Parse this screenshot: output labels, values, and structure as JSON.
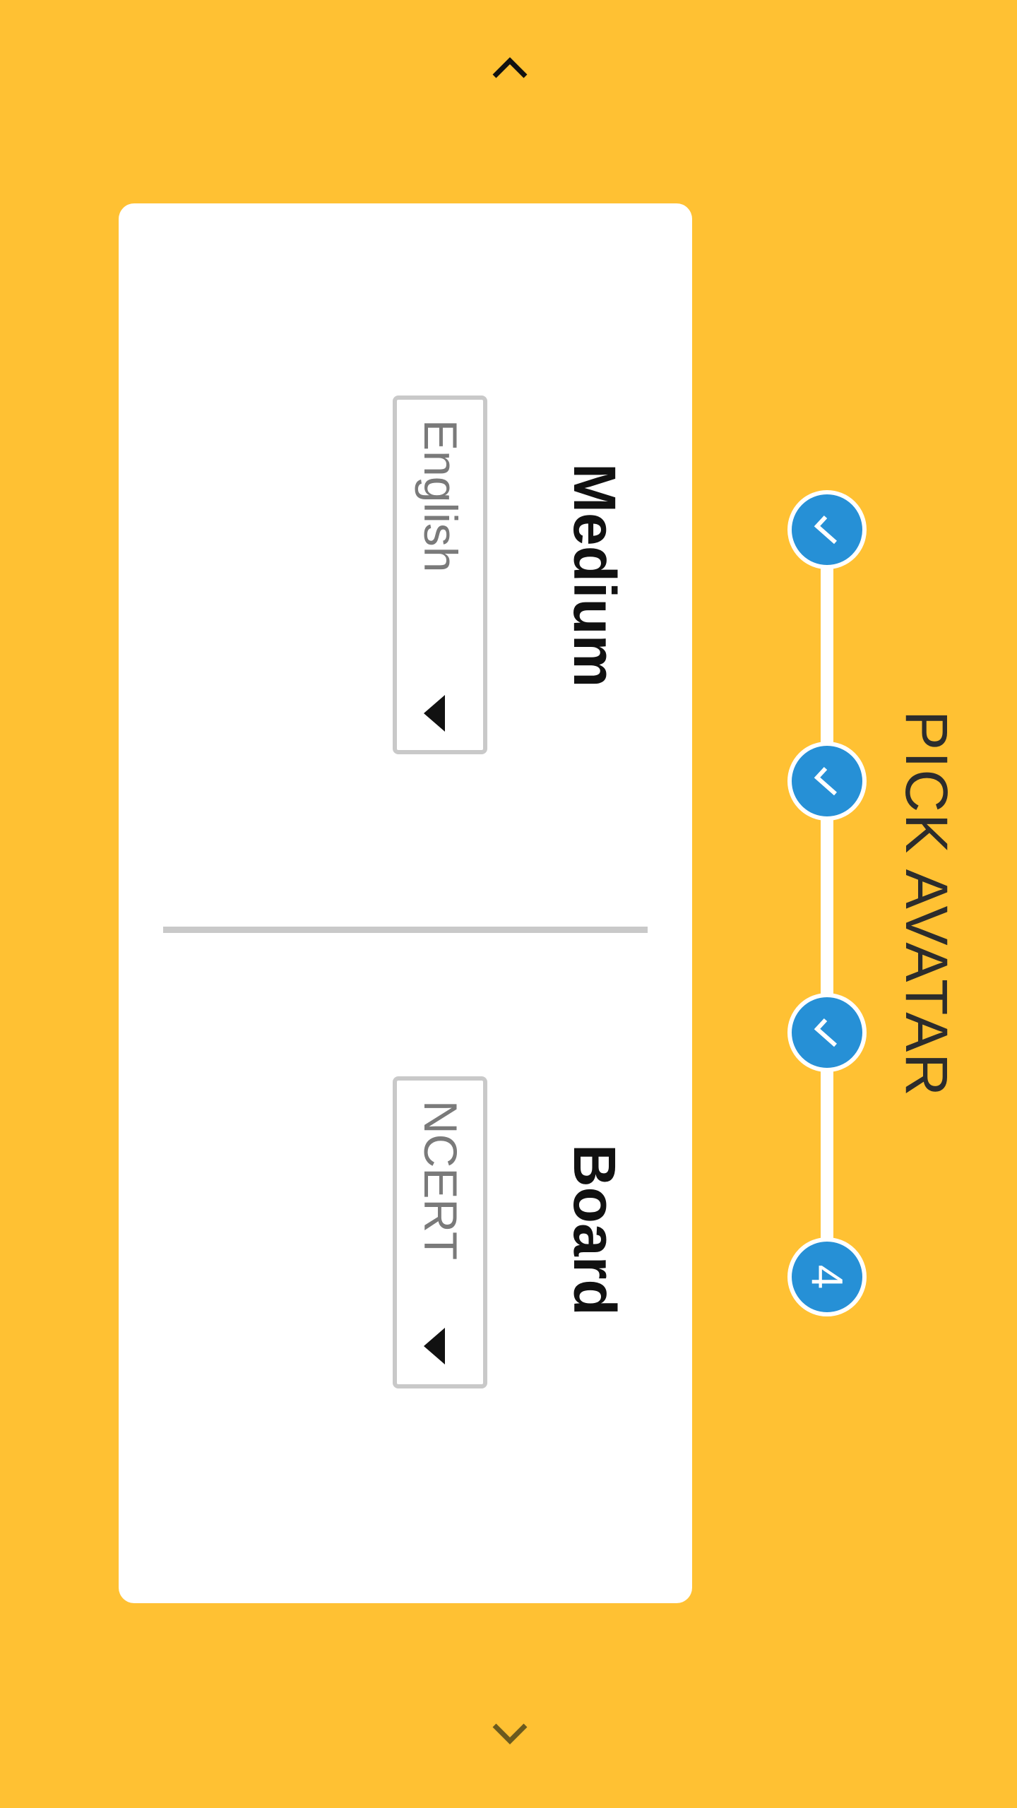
{
  "header": {
    "title": "PICK AVATAR"
  },
  "stepper": {
    "steps": [
      {
        "state": "done",
        "icon": "checkmark-icon"
      },
      {
        "state": "done",
        "icon": "checkmark-icon"
      },
      {
        "state": "done",
        "icon": "checkmark-icon"
      },
      {
        "state": "current",
        "label": "4"
      }
    ],
    "step_color": "#2690D6"
  },
  "form": {
    "medium": {
      "label": "Medium",
      "value": "English"
    },
    "board": {
      "label": "Board",
      "value": "NCERT"
    }
  },
  "navigation": {
    "prev_icon": "chevron-left-icon",
    "next_icon": "chevron-right-icon"
  },
  "theme": {
    "background": "#FFC133",
    "card": "#FFFFFF",
    "accent": "#2690D6"
  }
}
